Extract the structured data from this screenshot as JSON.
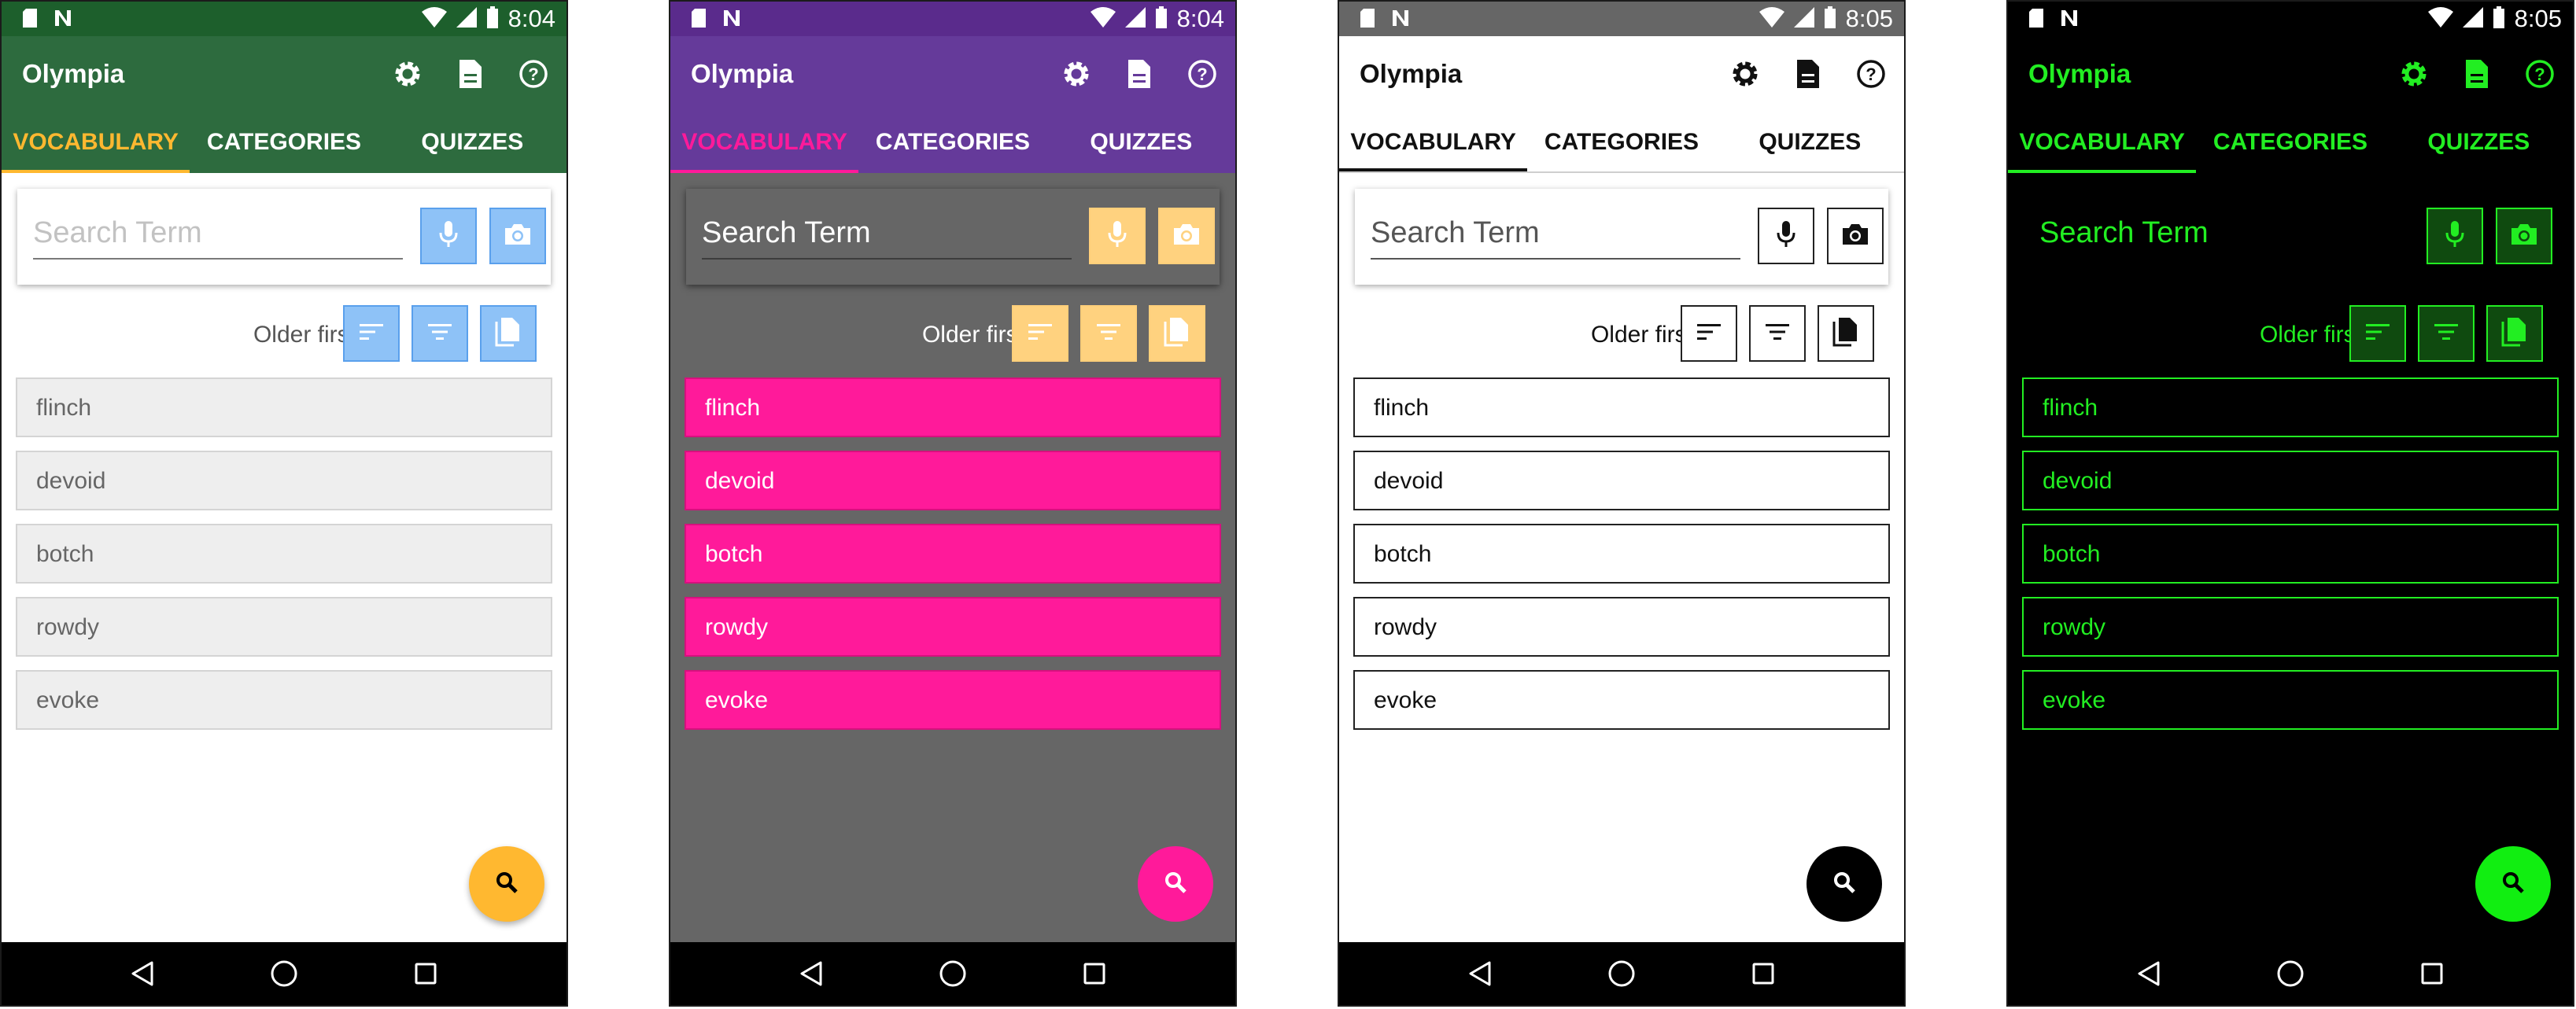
{
  "status": {
    "times": [
      "8:04",
      "8:04",
      "8:05",
      "8:05"
    ],
    "icons": [
      "sd-card-icon",
      "notification-n-icon",
      "wifi-icon",
      "signal-icon",
      "battery-icon"
    ]
  },
  "app": {
    "title": "Olympia"
  },
  "actions": [
    "settings-gear-icon",
    "document-icon",
    "help-icon"
  ],
  "tabs": [
    "VOCABULARY",
    "CATEGORIES",
    "QUIZZES"
  ],
  "search": {
    "placeholder": "Search Term"
  },
  "sort": {
    "label": "Older first"
  },
  "terms": [
    "flinch",
    "devoid",
    "botch",
    "rowdy",
    "evoke"
  ],
  "themes": [
    {
      "name": "green",
      "accent": "#ffb830",
      "bar": "#2d6b3e",
      "button": "#8ec2f7"
    },
    {
      "name": "purple",
      "accent": "#ff1a9a",
      "bar": "#653a9a",
      "button": "#ffd27f"
    },
    {
      "name": "light",
      "accent": "#000000",
      "bar": "#ffffff",
      "button": "#ffffff"
    },
    {
      "name": "dark",
      "accent": "#22ee22",
      "bar": "#000000",
      "button": "#0f4a0f"
    }
  ]
}
